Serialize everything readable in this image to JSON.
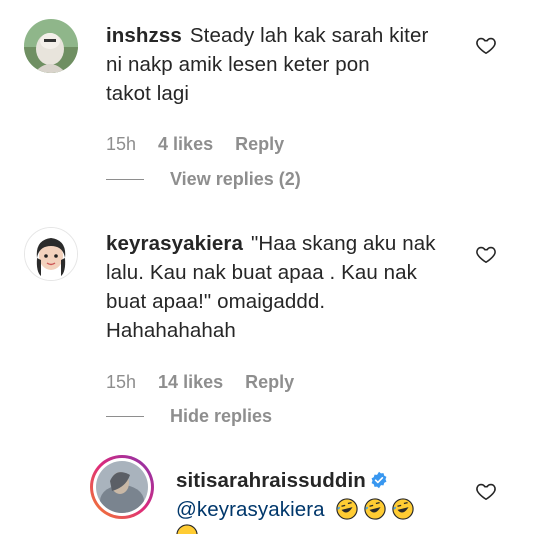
{
  "comments": [
    {
      "username": "inshzss",
      "text": "Steady lah kak sarah kiter ni nakp amik lesen keter pon takot lagi",
      "lines": [
        "Steady lah kak sarah kiter",
        "ni nakp amik lesen keter pon",
        "takot lagi"
      ],
      "time": "15h",
      "likes": "4 likes",
      "reply_label": "Reply",
      "replies_toggle": "View replies (2)"
    },
    {
      "username": "keyrasyakiera",
      "lines": [
        "\"Haa skang aku nak",
        "lalu. Kau nak buat apaa . Kau nak",
        "buat apaa!\" omaigaddd.",
        "Hahahahahah"
      ],
      "time": "15h",
      "likes": "14 likes",
      "reply_label": "Reply",
      "replies_toggle": "Hide replies"
    }
  ],
  "reply": {
    "username": "sitisarahraissuddin",
    "mention": "@keyrasyakiera",
    "emoji": "rolling-on-floor-laughing-emoji",
    "verified": true
  },
  "icons": {
    "heart": "heart-outline-icon",
    "verified": "verified-badge-icon"
  },
  "colors": {
    "text": "#262626",
    "muted": "#8e8e8e",
    "mention": "#00376b",
    "verified": "#3897f0",
    "story_ring_start": "#f58529",
    "story_ring_end": "#dd2a7b"
  }
}
